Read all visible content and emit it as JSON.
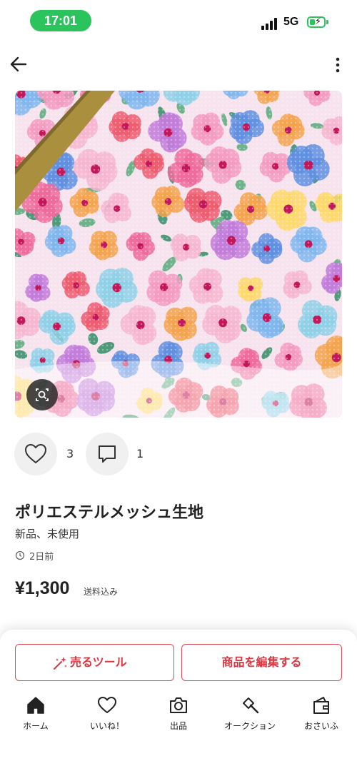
{
  "status_bar": {
    "time": "17:01",
    "network": "5G",
    "battery_charging": true,
    "colors": {
      "accent": "#2bc35b"
    }
  },
  "header": {
    "back_icon": "arrow-left-icon",
    "menu_icon": "more-vertical-icon"
  },
  "product": {
    "image_alt_icon": "image-search-icon",
    "likes": "3",
    "comments": "1",
    "title": "ポリエステルメッシュ生地",
    "condition": "新品、未使用",
    "posted": "2日前",
    "price": "¥1,300",
    "shipping_note": "送料込み"
  },
  "actions": {
    "tools_label": "売るツール",
    "edit_label": "商品を編集する",
    "colors": {
      "accent": "#e2343f"
    }
  },
  "tabs": [
    {
      "label": "ホーム",
      "icon": "home-icon"
    },
    {
      "label": "いいね！",
      "icon": "heart-icon"
    },
    {
      "label": "出品",
      "icon": "camera-icon"
    },
    {
      "label": "オークション",
      "icon": "gavel-icon"
    },
    {
      "label": "おさいふ",
      "icon": "wallet-icon"
    }
  ]
}
